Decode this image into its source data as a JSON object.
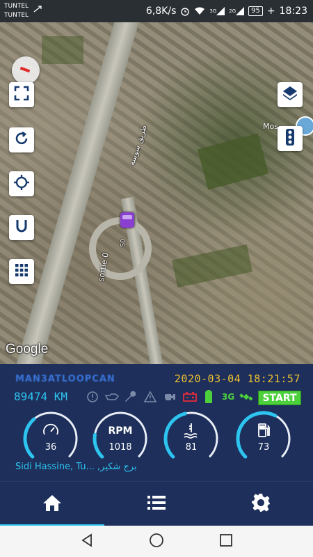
{
  "status_bar": {
    "carrier_1": "TUNTEL",
    "carrier_2": "TUNTEL",
    "speed": "6,8K/s",
    "network_1": "3G",
    "network_2": "2G",
    "battery": "95",
    "battery_plus": "+",
    "time": "18:23"
  },
  "map": {
    "street_label": "طريق سوسة",
    "exit_label": "sortie 0",
    "road_label": "S0",
    "poi_label": "Mos",
    "google_logo": "Google",
    "controls_left": [
      "compass-icon",
      "fullscreen-icon",
      "rotate-icon",
      "my-location-icon",
      "magnet-icon",
      "grid-icon"
    ],
    "controls_right": [
      "layers-icon",
      "traffic-light-icon"
    ]
  },
  "dashboard": {
    "brand": "MAN3ATLOOPCAN",
    "datetime": "2020-03-04 18:21:57",
    "odometer": "89474 KM",
    "indicators": [
      "warning-circle-icon",
      "oil-icon",
      "wrench-icon",
      "warning-triangle-icon",
      "engine-icon",
      "battery-alert-icon",
      "battery-level-icon"
    ],
    "network": "3G",
    "start_label": "START",
    "gauges": [
      {
        "name": "speed",
        "icon": "speedometer-icon",
        "label": "",
        "value": "36",
        "fraction": 0.35,
        "color": "#2ec4f0"
      },
      {
        "name": "rpm",
        "icon": "",
        "label": "RPM",
        "value": "1018",
        "fraction": 0.2,
        "color": "#2ec4f0"
      },
      {
        "name": "coolant",
        "icon": "thermometer-icon",
        "label": "",
        "value": "81",
        "fraction": 0.45,
        "color": "#2ec4f0"
      },
      {
        "name": "fuel",
        "icon": "fuel-pump-icon",
        "label": "",
        "value": "73",
        "fraction": 0.6,
        "color": "#2ec4f0"
      }
    ],
    "location": "Sidi Hassine, Tu... ,برج شكير"
  },
  "bottom_nav": {
    "items": [
      "home-icon",
      "list-icon",
      "settings-icon"
    ],
    "active": "home"
  },
  "system_nav": [
    "back-icon",
    "home-circle-icon",
    "recents-icon"
  ]
}
